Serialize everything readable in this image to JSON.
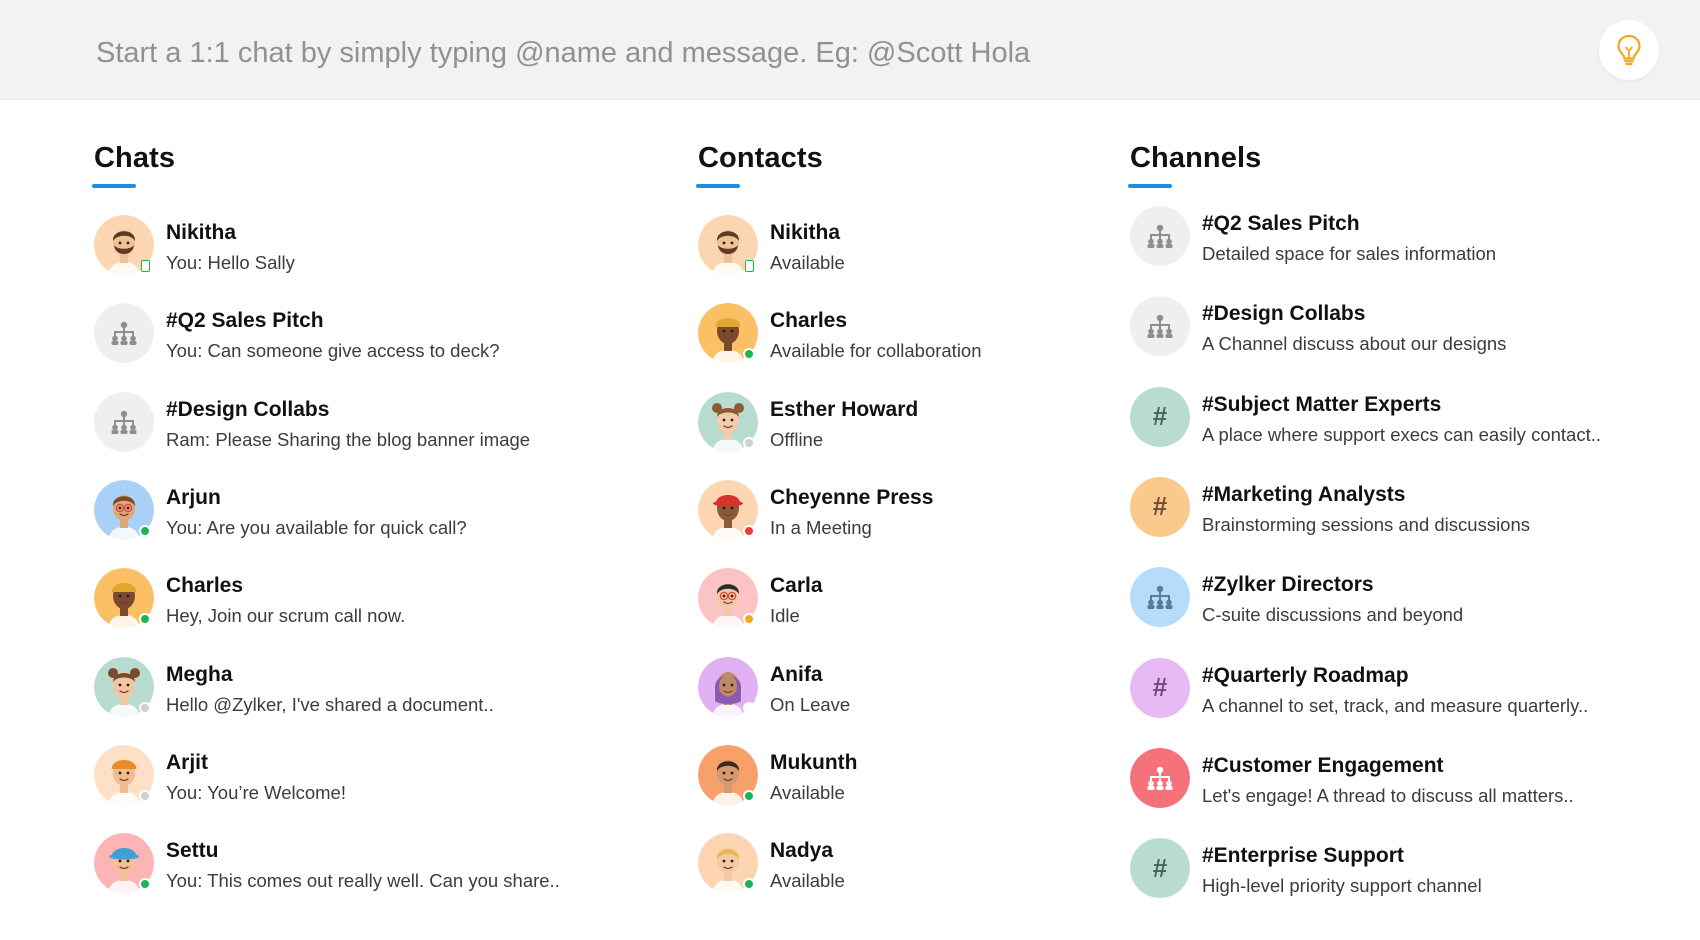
{
  "compose": {
    "placeholder": "Start a 1:1 chat by simply typing @name and message. Eg: @Scott Hola"
  },
  "tip_icon": "lightbulb-icon",
  "colors": {
    "accent": "#1d8fe0",
    "online": "#1fb355",
    "offline": "#cfcfcf",
    "busy": "#e8413b",
    "idle": "#f5a623",
    "lightbulb": "#f5a623"
  },
  "sections": {
    "chats": {
      "title": "Chats"
    },
    "contacts": {
      "title": "Contacts"
    },
    "channels": {
      "title": "Channels"
    }
  },
  "chats": [
    {
      "name": "Nikitha",
      "message": "You:  Hello Sally",
      "avatar": "avatar-nikitha",
      "status": "online-mobile"
    },
    {
      "name": "#Q2 Sales Pitch",
      "message": "You:  Can someone give access to deck?",
      "avatar": "org-chart-icon",
      "status": "none"
    },
    {
      "name": "#Design Collabs",
      "message": "Ram: Please Sharing the blog banner image",
      "avatar": "org-chart-icon",
      "status": "none"
    },
    {
      "name": "Arjun",
      "message": "You:  Are you available for quick call?",
      "avatar": "avatar-arjun",
      "status": "online"
    },
    {
      "name": "Charles",
      "message": "Hey, Join our scrum call now.",
      "avatar": "avatar-charles",
      "status": "online"
    },
    {
      "name": "Megha",
      "message": "Hello @Zylker, I've shared a document..",
      "avatar": "avatar-megha",
      "status": "offline"
    },
    {
      "name": "Arjit",
      "message": "You:  You’re Welcome!",
      "avatar": "avatar-arjit",
      "status": "offline"
    },
    {
      "name": "Settu",
      "message": "You:  This comes out really well. Can you share..",
      "avatar": "avatar-settu",
      "status": "online"
    }
  ],
  "contacts": [
    {
      "name": "Nikitha",
      "status_text": "Available",
      "avatar": "avatar-nikitha",
      "status": "online-mobile"
    },
    {
      "name": "Charles",
      "status_text": "Available for collaboration",
      "avatar": "avatar-charles",
      "status": "online"
    },
    {
      "name": "Esther Howard",
      "status_text": "Offline",
      "avatar": "avatar-esther",
      "status": "offline"
    },
    {
      "name": "Cheyenne Press",
      "status_text": "In a Meeting",
      "avatar": "avatar-cheyenne",
      "status": "busy"
    },
    {
      "name": "Carla",
      "status_text": "Idle",
      "avatar": "avatar-carla",
      "status": "idle"
    },
    {
      "name": "Anifa",
      "status_text": "On Leave",
      "avatar": "avatar-anifa",
      "status": "leave"
    },
    {
      "name": "Mukunth",
      "status_text": "Available",
      "avatar": "avatar-mukunth",
      "status": "online"
    },
    {
      "name": "Nadya",
      "status_text": "Available",
      "avatar": "avatar-nadya",
      "status": "online"
    }
  ],
  "channels": [
    {
      "name": "#Q2 Sales Pitch",
      "description": "Detailed space for sales information",
      "icon": "org-chart-icon",
      "color": "#efefef",
      "glyph_color": "#8e8e8e"
    },
    {
      "name": "#Design Collabs",
      "description": "A Channel discuss about our designs",
      "icon": "org-chart-icon",
      "color": "#efefef",
      "glyph_color": "#8e8e8e"
    },
    {
      "name": "#Subject Matter Experts",
      "description": "A place where support execs can easily contact..",
      "icon": "hash-icon",
      "color": "#b9dcd0",
      "glyph_color": "#4b6159"
    },
    {
      "name": "#Marketing Analysts",
      "description": "Brainstorming sessions and discussions",
      "icon": "hash-icon",
      "color": "#fcc98c",
      "glyph_color": "#6b5032"
    },
    {
      "name": "#Zylker Directors",
      "description": "C-suite discussions and beyond",
      "icon": "org-chart-icon",
      "color": "#b7dcfb",
      "glyph_color": "#5a7a96"
    },
    {
      "name": "#Quarterly Roadmap",
      "description": "A channel to set, track, and measure quarterly..",
      "icon": "hash-icon",
      "color": "#e7b9f5",
      "glyph_color": "#6d4a7a"
    },
    {
      "name": "#Customer Engagement",
      "description": "Let's engage! A thread to discuss all matters..",
      "icon": "org-chart-icon",
      "color": "#f5727a",
      "glyph_color": "#ffffff"
    },
    {
      "name": "#Enterprise Support",
      "description": "High-level priority support channel",
      "icon": "hash-icon",
      "color": "#b9dcd0",
      "glyph_color": "#4b6159"
    }
  ]
}
